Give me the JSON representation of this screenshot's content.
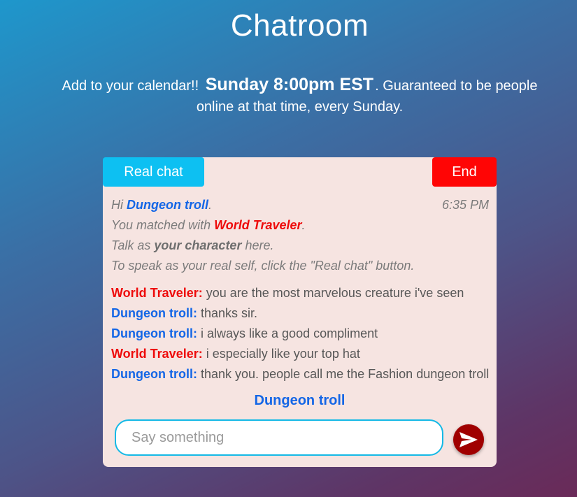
{
  "page": {
    "title": "Chatroom"
  },
  "announcement": {
    "prefix": "Add to your calendar!!",
    "time": "Sunday 8:00pm EST",
    "suffix_line1": ". Guaranteed to be people",
    "suffix_line2": "online at that time, every Sunday."
  },
  "chat": {
    "real_chat_label": "Real chat",
    "end_label": "End",
    "system": {
      "greeting_prefix": "Hi",
      "user_name": "Dungeon troll",
      "greeting_suffix": ".",
      "timestamp": "6:35 PM",
      "matched_prefix": "You matched with",
      "partner_name": "World Traveler",
      "matched_suffix": ".",
      "talk_prefix": "Talk as",
      "talk_emphasis": "your character",
      "talk_suffix": "here.",
      "real_self_hint": "To speak as your real self, click the \"Real chat\" button."
    },
    "messages": [
      {
        "sender": "World Traveler:",
        "text": "you are the most marvelous creature i've seen",
        "side": "partner"
      },
      {
        "sender": "Dungeon troll:",
        "text": "thanks sir.",
        "side": "self"
      },
      {
        "sender": "Dungeon troll:",
        "text": "i always like a good compliment",
        "side": "self"
      },
      {
        "sender": "World Traveler:",
        "text": "i especially like your top hat",
        "side": "partner"
      },
      {
        "sender": "Dungeon troll:",
        "text": "thank you. people call me the Fashion dungeon troll",
        "side": "self"
      }
    ],
    "speaking_as": "Dungeon troll",
    "input": {
      "placeholder": "Say something",
      "value": ""
    },
    "send_icon": "send-icon"
  },
  "colors": {
    "self_name": "#1466e6",
    "partner_name": "#ee0b0b",
    "real_chat_button": "#0dc0f2",
    "end_button": "#ff0505",
    "send_button": "#a00000",
    "panel_background": "#f6e4e1"
  }
}
